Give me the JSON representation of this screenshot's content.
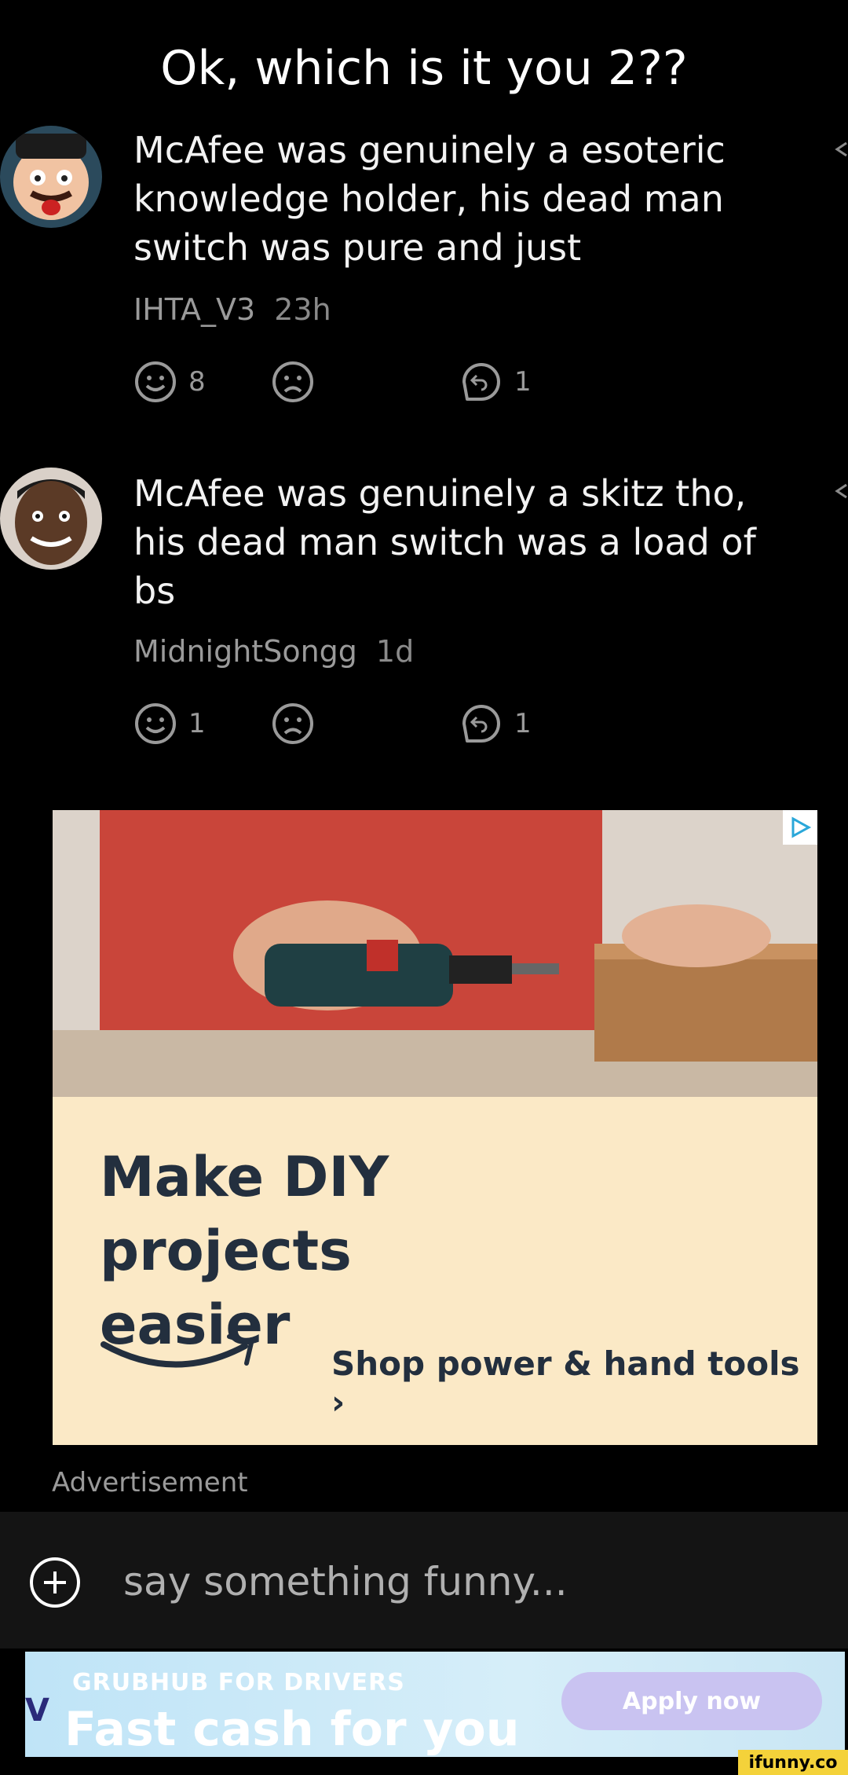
{
  "post": {
    "title": "Ok, which is it you 2??"
  },
  "comments": [
    {
      "text": "McAfee was genuinely a esoteric knowledge holder, his dead man switch was pure and just",
      "author": "IHTA_V3",
      "time": "23h",
      "smile_count": "8",
      "reply_count": "1"
    },
    {
      "text": "McAfee was genuinely a skitz tho, his dead man switch was a load of bs",
      "author": "MidnightSongg",
      "time": "1d",
      "smile_count": "1",
      "reply_count": "1"
    }
  ],
  "ad": {
    "headline": "Make DIY projects easier",
    "cta": "Shop power & hand tools ›",
    "label": "Advertisement"
  },
  "compose": {
    "placeholder": "say something funny..."
  },
  "banner": {
    "brand": "GRUBHUB FOR DRIVERS",
    "headline": "Fast cash for you",
    "button": "Apply now"
  },
  "watermark": "ifunny.co",
  "colors": {
    "background": "#000000",
    "ad_bg": "#fbe9c6",
    "ad_text": "#232f3e",
    "muted": "#9a9a9a"
  }
}
